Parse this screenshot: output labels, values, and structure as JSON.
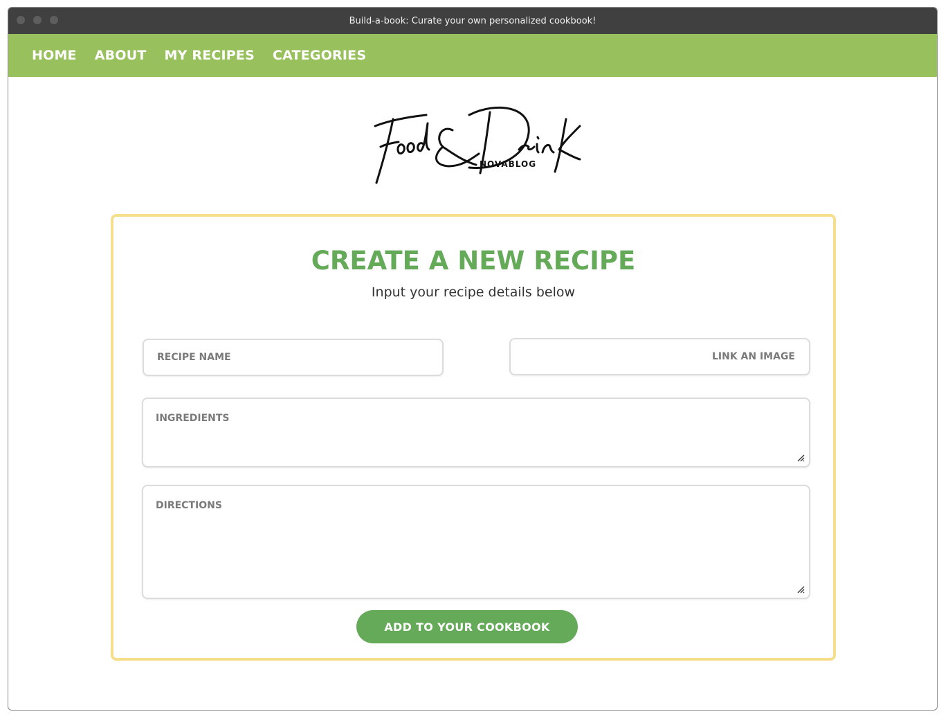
{
  "window": {
    "title": "Build-a-book: Curate your own personalized cookbook!"
  },
  "nav": {
    "items": [
      {
        "label": "HOME"
      },
      {
        "label": "ABOUT"
      },
      {
        "label": "MY RECIPES"
      },
      {
        "label": "CATEGORIES"
      }
    ],
    "background_color": "#98c15d"
  },
  "logo": {
    "script_text": "Food & Drink",
    "sub_text": "NOVABLOG"
  },
  "form": {
    "title": "CREATE A NEW RECIPE",
    "subtitle": "Input your recipe details below",
    "recipe_name": {
      "value": "",
      "placeholder": "RECIPE NAME"
    },
    "image_link": {
      "value": "",
      "placeholder": "LINK AN IMAGE"
    },
    "ingredients": {
      "value": "",
      "placeholder": "INGREDIENTS"
    },
    "directions": {
      "value": "",
      "placeholder": "DIRECTIONS"
    },
    "submit_label": "ADD TO YOUR COOKBOOK",
    "title_color": "#64aa59",
    "border_color": "#f6df8c",
    "button_color": "#65aa59"
  }
}
